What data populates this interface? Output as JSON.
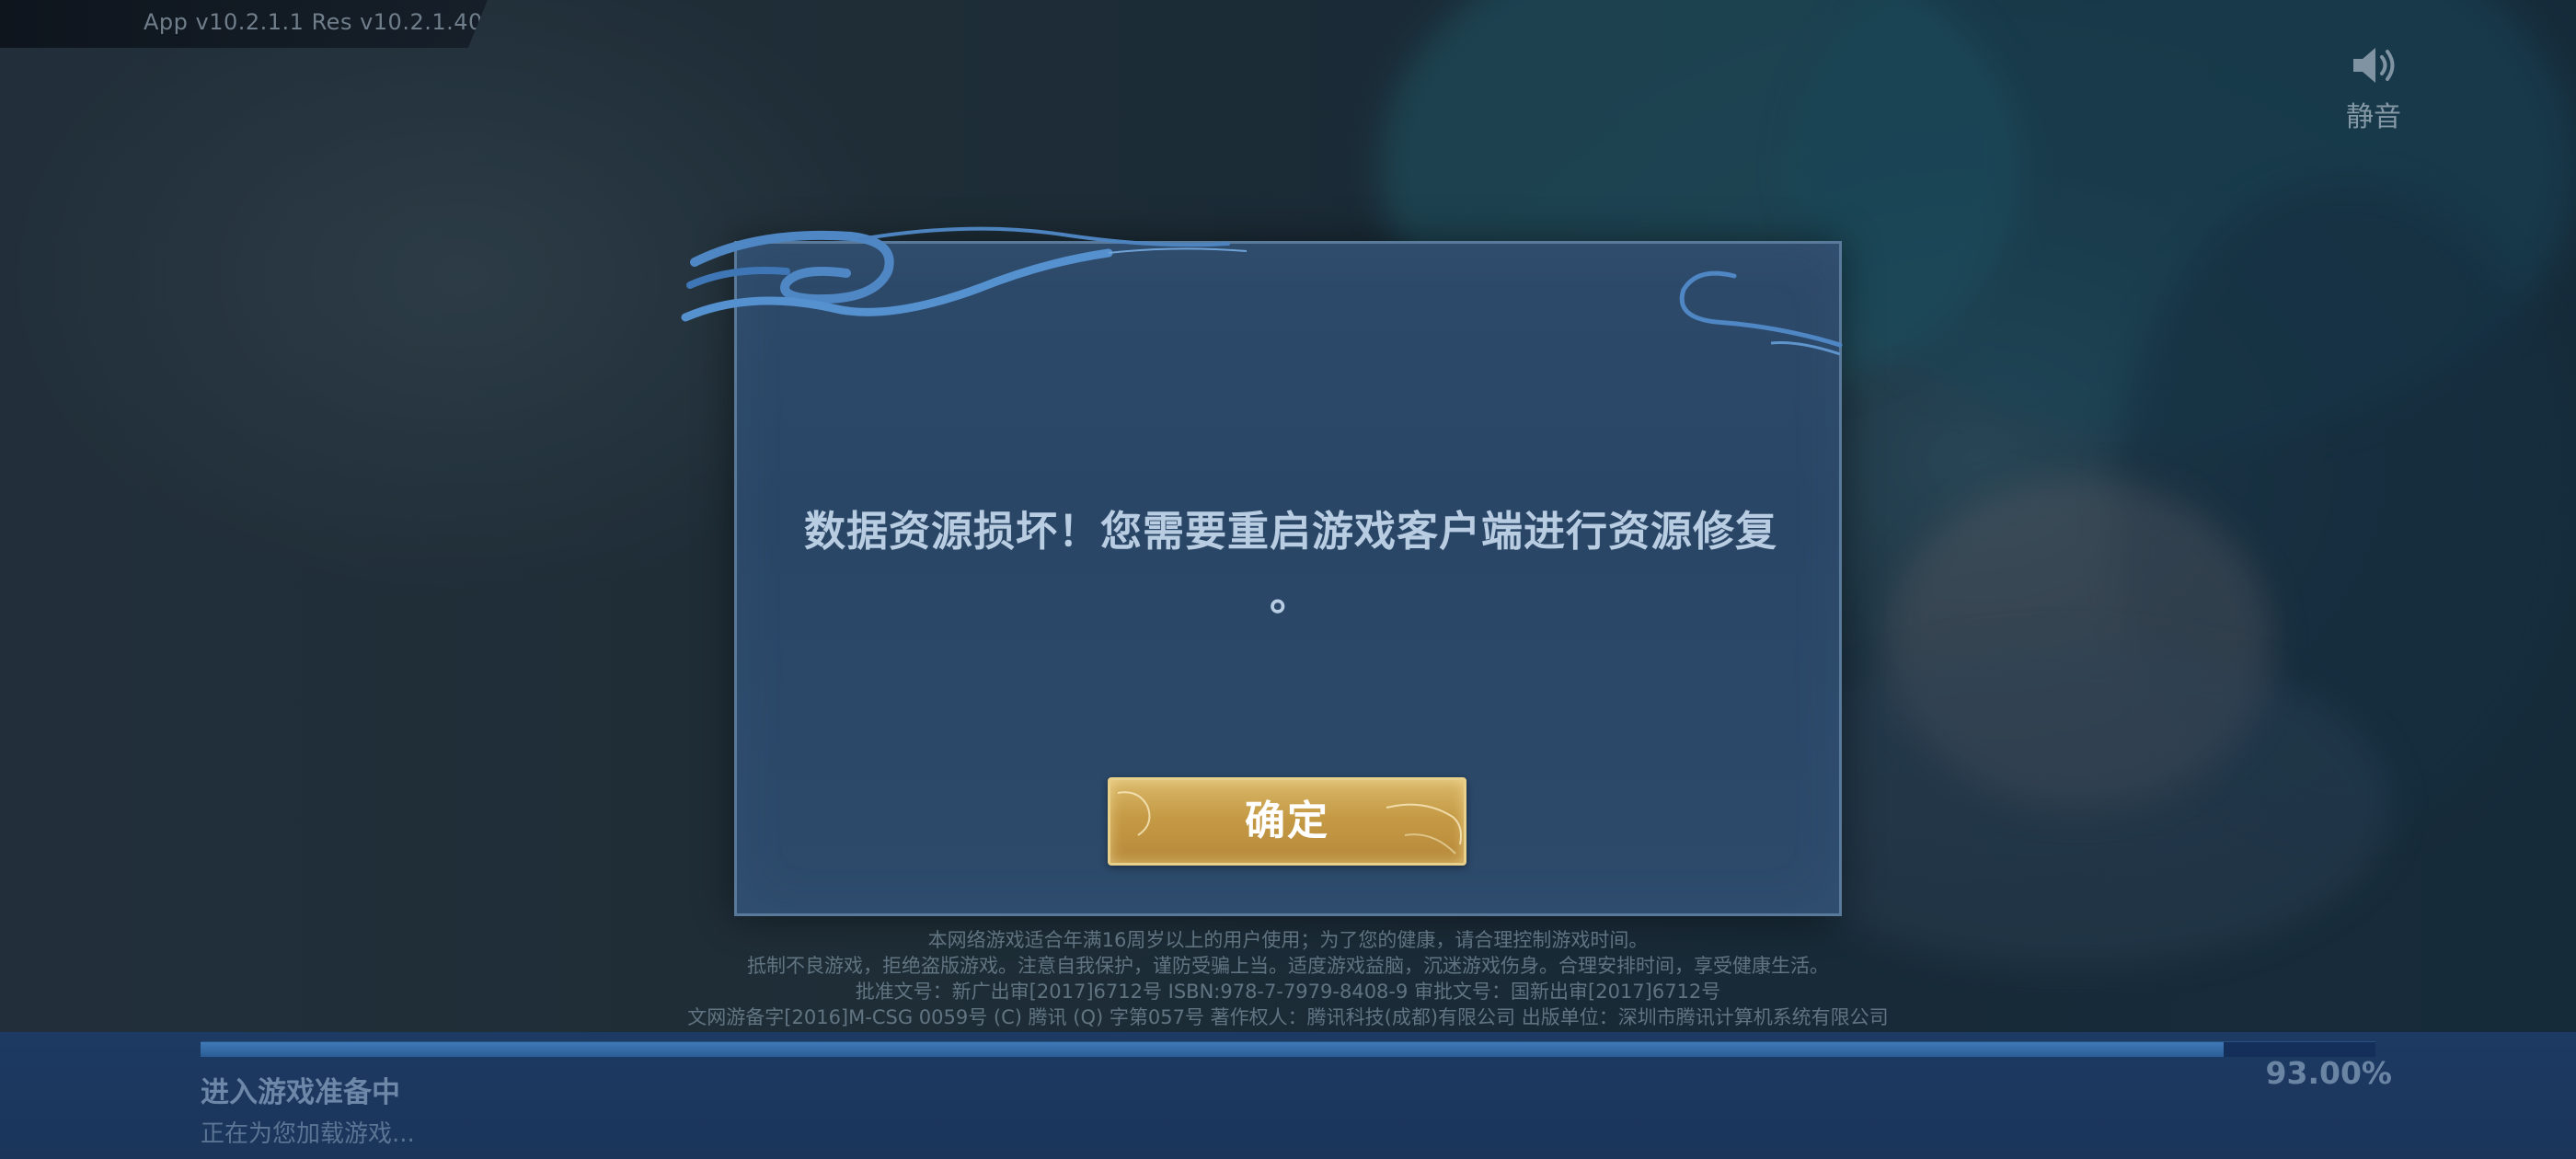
{
  "version": {
    "text": "App v10.2.1.1   Res v10.2.1.40"
  },
  "mute": {
    "icon": "speaker-icon",
    "label": "静音"
  },
  "dialog": {
    "message_line1": "数据资源损坏！您需要重启游戏客户端进行资源修复",
    "message_line2": "。",
    "confirm_label": "确定"
  },
  "legal": {
    "lines": [
      "本网络游戏适合年满16周岁以上的用户使用；为了您的健康，请合理控制游戏时间。",
      "抵制不良游戏，拒绝盗版游戏。注意自我保护，谨防受骗上当。适度游戏益脑，沉迷游戏伤身。合理安排时间，享受健康生活。",
      "批准文号：新广出审[2017]6712号  ISBN:978-7-7979-8408-9  审批文号：国新出审[2017]6712号",
      "文网游备字[2016]M-CSG 0059号  (C) 腾讯  (Q) 字第057号  著作权人：腾讯科技(成都)有限公司  出版单位：深圳市腾讯计算机系统有限公司"
    ]
  },
  "loading": {
    "title": "进入游戏准备中",
    "subtitle": "正在为您加载游戏...",
    "percent_text": "93.00%",
    "progress": 0.93
  },
  "colors": {
    "dialog_bg": "#2b4767",
    "dialog_border": "#5a7a9c",
    "button_gold": "#c59a45",
    "progress_fill": "#3f79b6",
    "bottom_panel": "#1c3a63"
  }
}
